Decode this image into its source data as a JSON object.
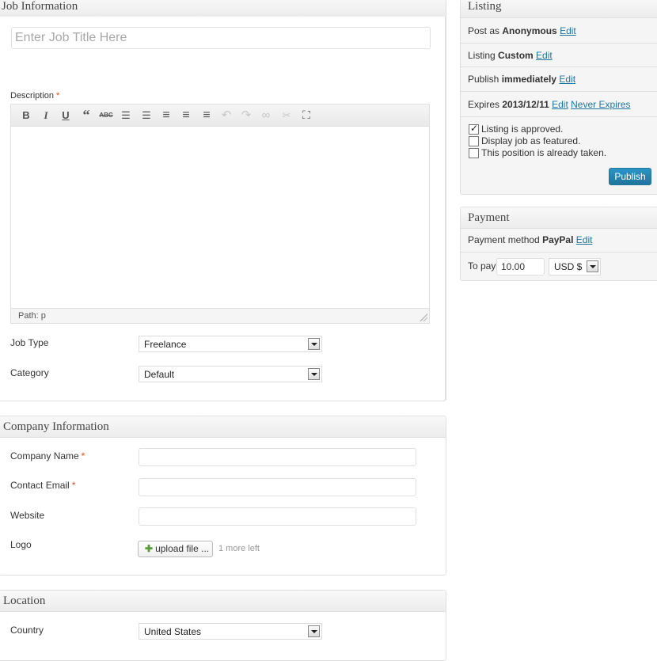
{
  "job_info": {
    "header": "Job Information",
    "title_placeholder": "Enter Job Title Here",
    "description_label": "Description",
    "required_mark": "*",
    "editor_path": "Path: p",
    "job_type_label": "Job Type",
    "job_type_value": "Freelance",
    "category_label": "Category",
    "category_value": "Default"
  },
  "toolbar_icons": [
    "bold-icon",
    "italic-icon",
    "underline-icon",
    "blockquote-icon",
    "strikethrough-icon",
    "bullet-list-icon",
    "numbered-list-icon",
    "align-left-icon",
    "align-center-icon",
    "align-right-icon",
    "undo-icon",
    "redo-icon",
    "link-icon",
    "unlink-icon",
    "fullscreen-icon"
  ],
  "toolbar_glyphs": {
    "bold": "B",
    "italic": "I",
    "underline": "U",
    "quote": "“",
    "strike": "ABC",
    "ul": "☰",
    "ol": "☰",
    "left": "≡",
    "center": "≡",
    "right": "≡",
    "undo": "↶",
    "redo": "↷",
    "link": "∞",
    "unlink": "✂",
    "full": "⛶"
  },
  "company": {
    "header": "Company Information",
    "name_label": "Company Name",
    "email_label": "Contact Email",
    "website_label": "Website",
    "logo_label": "Logo",
    "upload_label": "upload file ...",
    "upload_note": "1 more left"
  },
  "location": {
    "header": "Location",
    "country_label": "Country",
    "country_value": "United States"
  },
  "listing": {
    "header": "Listing",
    "post_as_prefix": "Post as",
    "post_as_value": "Anonymous",
    "listing_prefix": "Listing",
    "listing_value": "Custom",
    "publish_prefix": "Publish",
    "publish_value": "immediately",
    "expires_prefix": "Expires",
    "expires_value": "2013/12/11",
    "edit_link": "Edit",
    "never_expires_link": "Never Expires",
    "approved_label": "Listing is approved.",
    "approved_checked": true,
    "featured_label": "Display job as featured.",
    "featured_checked": false,
    "taken_label": "This position is already taken.",
    "taken_checked": false,
    "publish_button": "Publish"
  },
  "payment": {
    "header": "Payment",
    "method_prefix": "Payment method",
    "method_value": "PayPal",
    "edit_link": "Edit",
    "to_pay_label": "To pay",
    "amount": "10.00",
    "currency": "USD $"
  },
  "colors": {
    "link": "#21759b",
    "required": "#d54e21",
    "primary_button": "#21759b"
  }
}
